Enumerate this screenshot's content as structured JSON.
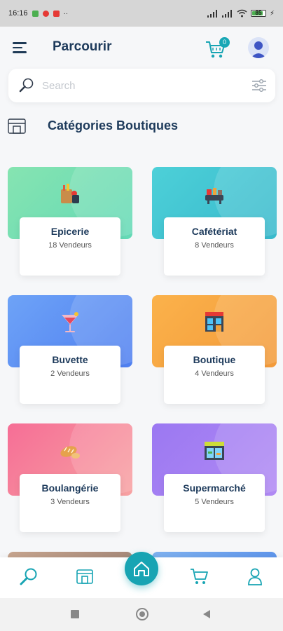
{
  "status_bar": {
    "time": "16:16",
    "battery": "85",
    "battery_level": 0.85
  },
  "header": {
    "title": "Parcourir",
    "cart_count": "0"
  },
  "search": {
    "placeholder": "Search"
  },
  "section": {
    "title": "Catégories Boutiques"
  },
  "categories": [
    {
      "name": "Epicerie",
      "count": "18 Vendeurs",
      "icon": "grocery-bag-icon",
      "gradient": [
        "#86e4b1",
        "#63d9b6"
      ]
    },
    {
      "name": "Cafétériat",
      "count": "8 Vendeurs",
      "icon": "cafeteria-icon",
      "gradient": [
        "#4dd0d8",
        "#38b9cc"
      ]
    },
    {
      "name": "Buvette",
      "count": "2 Vendeurs",
      "icon": "cocktail-icon",
      "gradient": [
        "#6ea3f7",
        "#4f7ff0"
      ]
    },
    {
      "name": "Boutique",
      "count": "4 Vendeurs",
      "icon": "shop-icon",
      "gradient": [
        "#fbb24b",
        "#f39a3a"
      ]
    },
    {
      "name": "Boulangérie",
      "count": "3 Vendeurs",
      "icon": "bread-icon",
      "gradient": [
        "#f66e96",
        "#f7a2a2"
      ]
    },
    {
      "name": "Supermarché",
      "count": "5 Vendeurs",
      "icon": "supermarket-icon",
      "gradient": [
        "#9b78f2",
        "#b18af4"
      ]
    }
  ],
  "colors": {
    "accent": "#17a4b3",
    "title": "#1d3a5b"
  }
}
